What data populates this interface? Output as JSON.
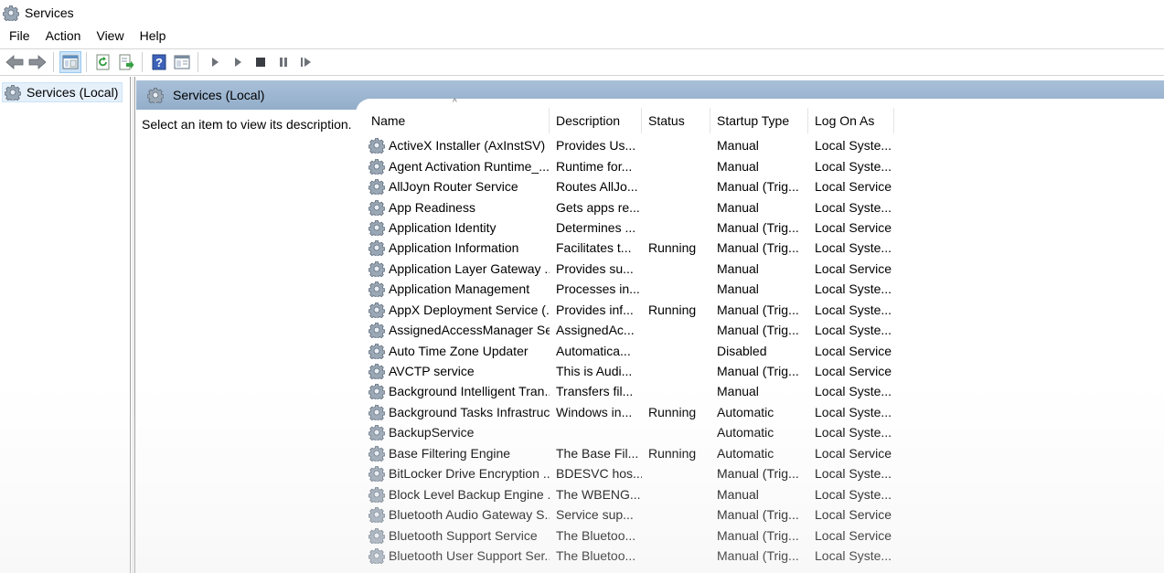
{
  "window": {
    "title": "Services"
  },
  "menu": [
    "File",
    "Action",
    "View",
    "Help"
  ],
  "toolbar": {
    "buttons": [
      "back-icon",
      "forward-icon",
      "show-hide-console-tree-icon",
      "refresh-icon",
      "export-list-icon",
      "help-icon",
      "properties-view-icon",
      "start-service-icon",
      "start-service-alt-icon",
      "stop-service-icon",
      "pause-service-icon",
      "resume-service-icon"
    ]
  },
  "tree": {
    "root_label": "Services (Local)"
  },
  "content": {
    "header_title": "Services (Local)",
    "description_prompt": "Select an item to view its description."
  },
  "table": {
    "columns": [
      "Name",
      "Description",
      "Status",
      "Startup Type",
      "Log On As"
    ],
    "sorted_column": "Name",
    "rows": [
      [
        "ActiveX Installer (AxInstSV)",
        "Provides Us...",
        "",
        "Manual",
        "Local Syste..."
      ],
      [
        "Agent Activation Runtime_...",
        "Runtime for...",
        "",
        "Manual",
        "Local Syste..."
      ],
      [
        "AllJoyn Router Service",
        "Routes AllJo...",
        "",
        "Manual (Trig...",
        "Local Service"
      ],
      [
        "App Readiness",
        "Gets apps re...",
        "",
        "Manual",
        "Local Syste..."
      ],
      [
        "Application Identity",
        "Determines ...",
        "",
        "Manual (Trig...",
        "Local Service"
      ],
      [
        "Application Information",
        "Facilitates t...",
        "Running",
        "Manual (Trig...",
        "Local Syste..."
      ],
      [
        "Application Layer Gateway ...",
        "Provides su...",
        "",
        "Manual",
        "Local Service"
      ],
      [
        "Application Management",
        "Processes in...",
        "",
        "Manual",
        "Local Syste..."
      ],
      [
        "AppX Deployment Service (...",
        "Provides inf...",
        "Running",
        "Manual (Trig...",
        "Local Syste..."
      ],
      [
        "AssignedAccessManager Se...",
        "AssignedAc...",
        "",
        "Manual (Trig...",
        "Local Syste..."
      ],
      [
        "Auto Time Zone Updater",
        "Automatica...",
        "",
        "Disabled",
        "Local Service"
      ],
      [
        "AVCTP service",
        "This is Audi...",
        "",
        "Manual (Trig...",
        "Local Service"
      ],
      [
        "Background Intelligent Tran...",
        "Transfers fil...",
        "",
        "Manual",
        "Local Syste..."
      ],
      [
        "Background Tasks Infrastruc...",
        "Windows in...",
        "Running",
        "Automatic",
        "Local Syste..."
      ],
      [
        "BackupService",
        "",
        "",
        "Automatic",
        "Local Syste..."
      ],
      [
        "Base Filtering Engine",
        "The Base Fil...",
        "Running",
        "Automatic",
        "Local Service"
      ],
      [
        "BitLocker Drive Encryption ...",
        "BDESVC hos...",
        "",
        "Manual (Trig...",
        "Local Syste..."
      ],
      [
        "Block Level Backup Engine ...",
        "The WBENG...",
        "",
        "Manual",
        "Local Syste..."
      ],
      [
        "Bluetooth Audio Gateway S...",
        "Service sup...",
        "",
        "Manual (Trig...",
        "Local Service"
      ],
      [
        "Bluetooth Support Service",
        "The Bluetoo...",
        "",
        "Manual (Trig...",
        "Local Service"
      ],
      [
        "Bluetooth User Support Ser...",
        "The Bluetoo...",
        "",
        "Manual (Trig...",
        "Local Syste..."
      ]
    ]
  },
  "colors": {
    "header_gradient_top": "#a9bfd8",
    "header_gradient_bottom": "#93aeca",
    "selection": "#e5f0fb"
  }
}
